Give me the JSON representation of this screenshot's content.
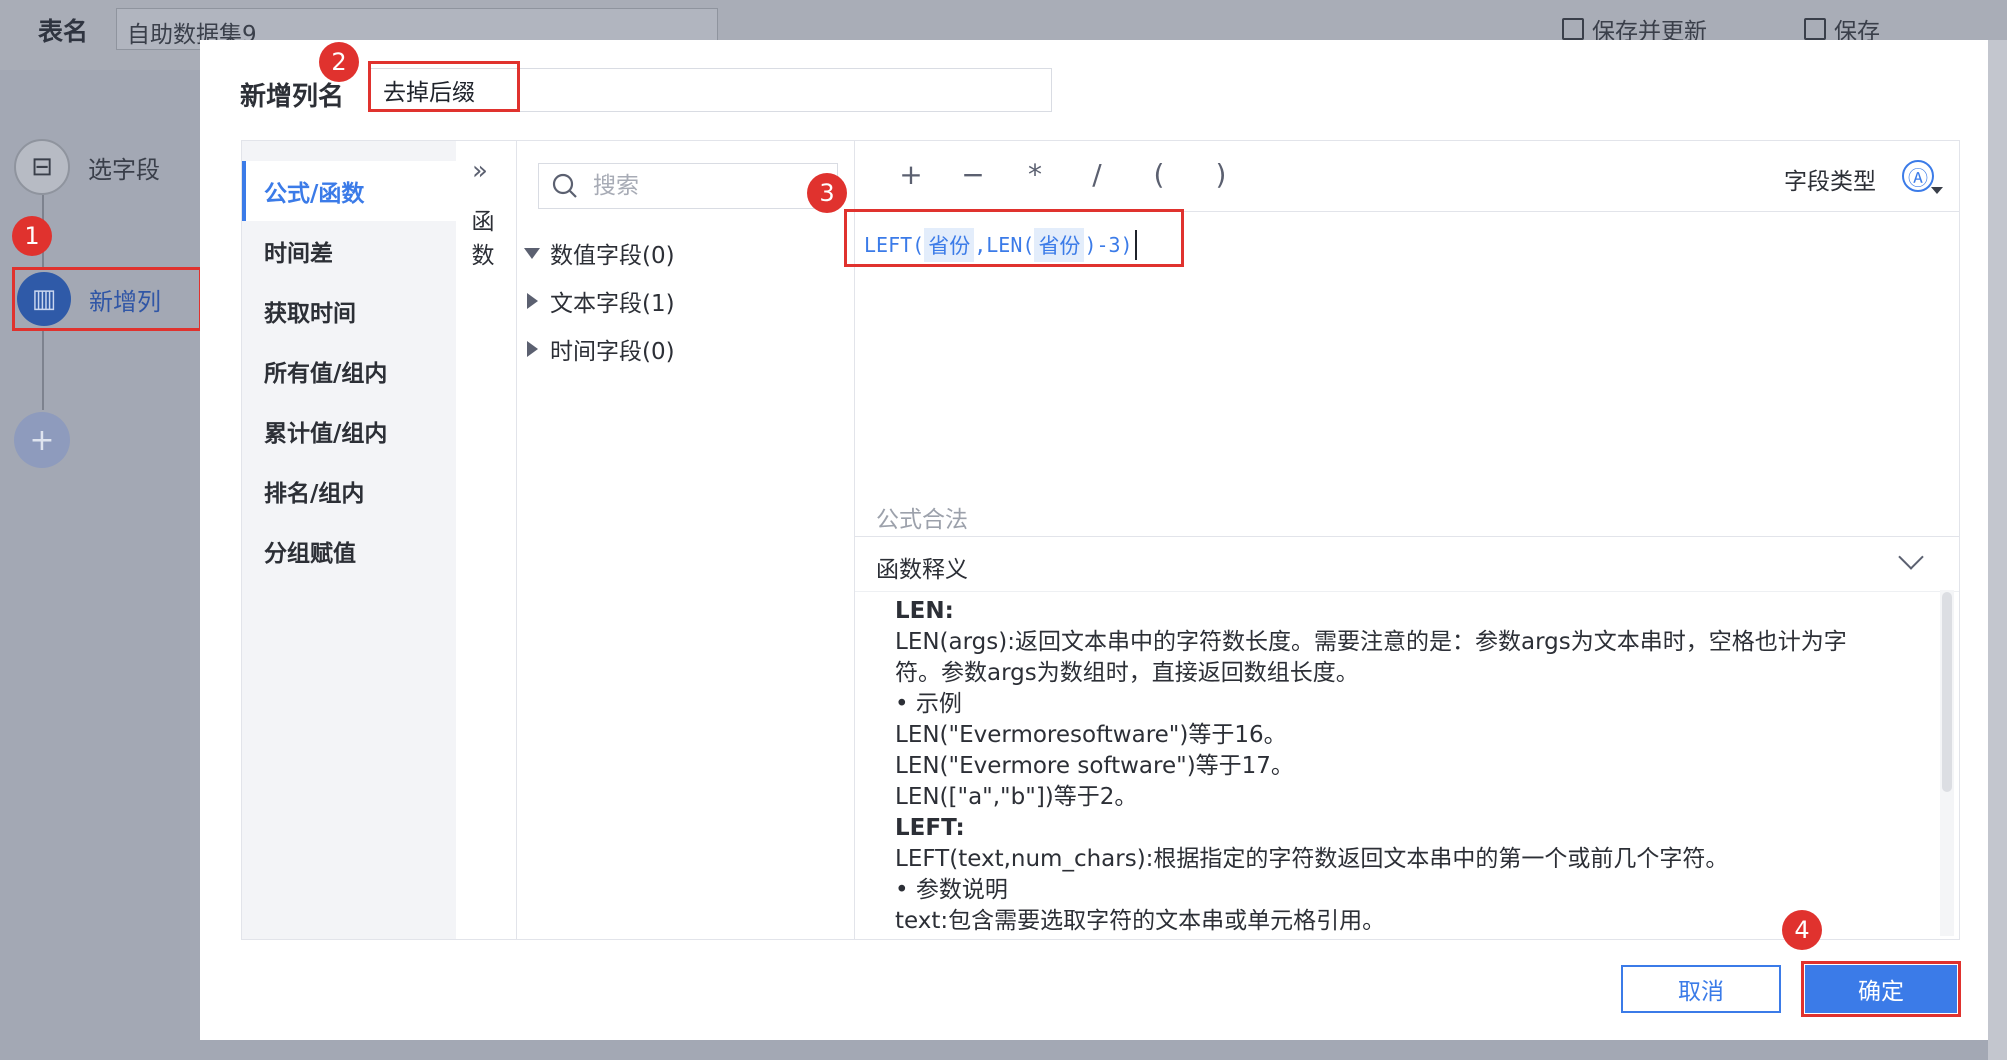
{
  "background": {
    "table_label": "表名",
    "table_name": "自助数据集9",
    "save_update": "保存并更新",
    "save": "保存",
    "steps": [
      {
        "label": "选字段"
      },
      {
        "label": "新增列"
      }
    ]
  },
  "dialog": {
    "title": "新增列名",
    "column_name_value": "去掉后缀",
    "categories": [
      "公式/函数",
      "时间差",
      "获取时间",
      "所有值/组内",
      "累计值/组内",
      "排名/组内",
      "分组赋值"
    ],
    "function_tab": "函数",
    "search_placeholder": "搜索",
    "field_groups": [
      "数值字段(0)",
      "文本字段(1)",
      "时间字段(0)"
    ],
    "operators": [
      "+",
      "−",
      "*",
      "/",
      "(",
      ")"
    ],
    "field_type_label": "字段类型",
    "field_type_icon": "Ⓐ",
    "formula": {
      "p1": "LEFT(",
      "field1": "省份",
      "p2": ",LEN(",
      "field2": "省份",
      "p3": ")-3)"
    },
    "formula_status": "公式合法",
    "doc_title": "函数释义",
    "doc_lines": [
      "LEN:",
      "LEN(args):返回文本串中的字符数长度。需要注意的是：参数args为文本串时，空格也计为字",
      "符。参数args为数组时，直接返回数组长度。",
      "•  示例",
      "LEN(\"Evermoresoftware\")等于16。",
      "LEN(\"Evermore software\")等于17。",
      "LEN([\"a\",\"b\"])等于2。",
      "LEFT:",
      "LEFT(text,num_chars):根据指定的字符数返回文本串中的第一个或前几个字符。",
      "•  参数说明",
      "text:包含需要选取字符的文本串或单元格引用。"
    ],
    "cancel": "取消",
    "confirm": "确定"
  },
  "annotations": [
    "1",
    "2",
    "3",
    "4"
  ],
  "colors": {
    "accent": "#3b7be8",
    "highlight": "#e0322e"
  }
}
